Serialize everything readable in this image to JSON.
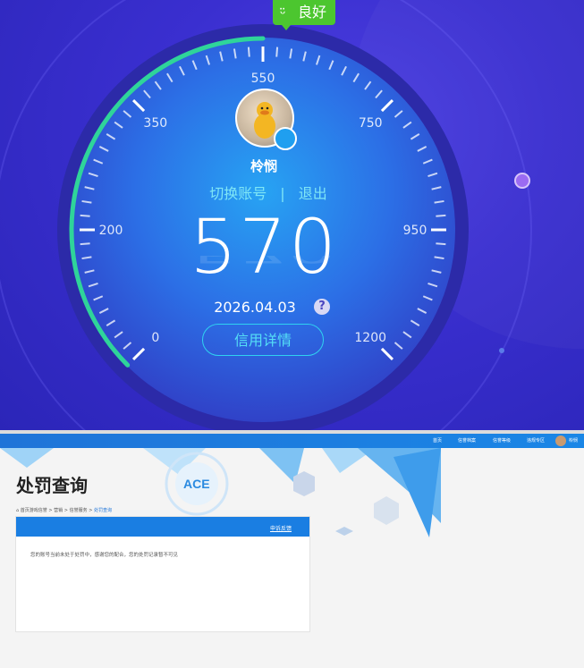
{
  "credit": {
    "badge": "良好",
    "score": "570",
    "date": "2026.04.03",
    "help": "?",
    "nickname": "柃悯",
    "switch_account": "切换账号",
    "separator": "|",
    "logout": "退出",
    "detail_button": "信用详情",
    "scale_labels": [
      "0",
      "200",
      "350",
      "550",
      "750",
      "950",
      "1200"
    ],
    "colors": {
      "badge": "#4cc62f",
      "progress": "#2fd49a",
      "accent": "#55dff6",
      "background": "#3a2fd0"
    }
  },
  "site": {
    "nav": [
      "首页",
      "信誉档案",
      "信誉等级",
      "违规专区",
      "柃悯"
    ],
    "page_title": "处罚查询",
    "breadcrumb": {
      "home": "首页游戏信誉",
      "sep": ">",
      "level1": "营销",
      "level2": "信誉服务",
      "current": "处罚查询"
    },
    "panel": {
      "feedback_link": "申诉反馈",
      "message": "您的账号当前未处于处罚中，感谢您的配合，您的处罚记录暂不可见"
    },
    "colors": {
      "nav": "#1f74d8",
      "panel_header": "#1a7ee2"
    }
  }
}
